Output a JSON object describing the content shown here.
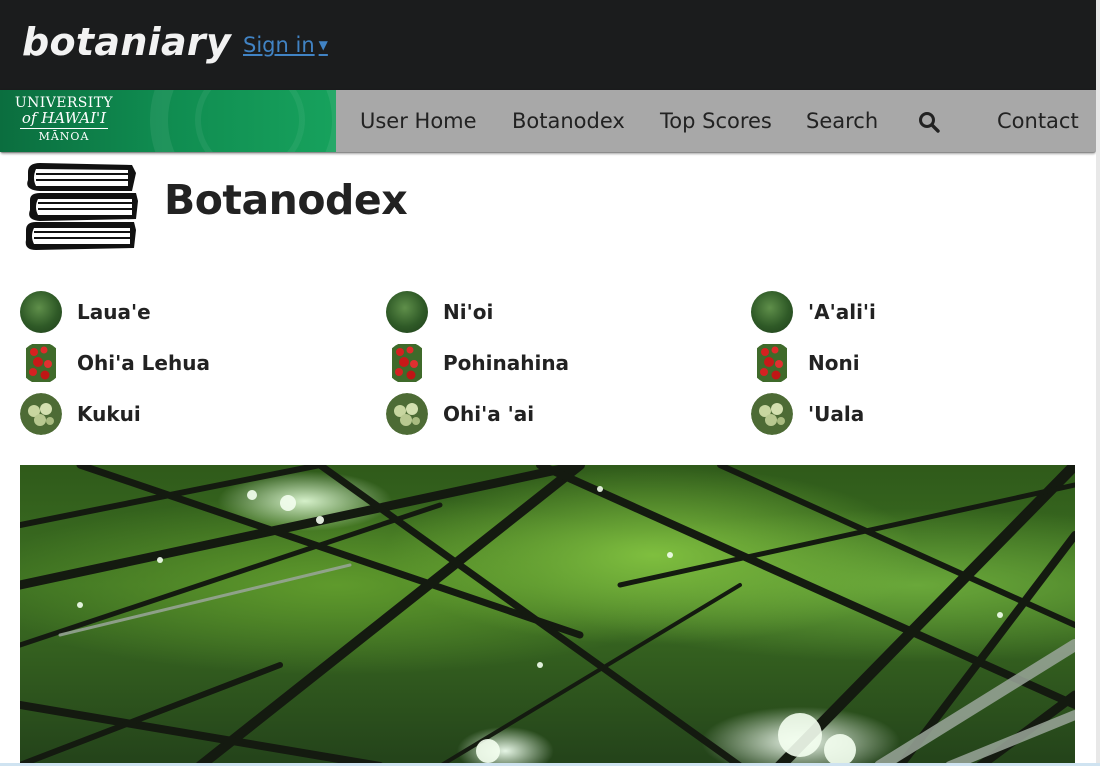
{
  "header": {
    "brand": "botaniary",
    "signin_label": "Sign in",
    "signin_caret": "▼"
  },
  "nav": {
    "logo": {
      "line1": "UNIVERSITY",
      "line2": "of HAWAI'I",
      "line3": "MĀNOA"
    },
    "items": [
      {
        "label": "User Home"
      },
      {
        "label": "Botanodex"
      },
      {
        "label": "Top Scores"
      },
      {
        "label": "Search"
      },
      {
        "label": "Contact"
      }
    ],
    "search_icon": "search-icon"
  },
  "page": {
    "title": "Botanodex",
    "title_icon": "books-icon"
  },
  "plants": [
    {
      "name": "Laua'e",
      "thumb": "fern"
    },
    {
      "name": "Ni'oi",
      "thumb": "fern"
    },
    {
      "name": "'A'ali'i",
      "thumb": "fern"
    },
    {
      "name": "Ohi'a Lehua",
      "thumb": "lehua"
    },
    {
      "name": "Pohinahina",
      "thumb": "lehua"
    },
    {
      "name": "Noni",
      "thumb": "lehua"
    },
    {
      "name": "Kukui",
      "thumb": "kukui"
    },
    {
      "name": "Ohi'a 'ai",
      "thumb": "kukui"
    },
    {
      "name": "'Uala",
      "thumb": "kukui"
    }
  ],
  "colors": {
    "topbar": "#1b1c1d",
    "navbar": "#a8a8a8",
    "link": "#4183c4",
    "uh_green": "#0f8a4f"
  }
}
